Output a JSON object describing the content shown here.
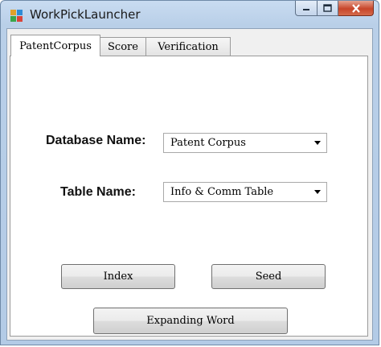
{
  "window": {
    "title": "WorkPickLauncher"
  },
  "tabs": [
    {
      "label": "PatentCorpus"
    },
    {
      "label": "Score"
    },
    {
      "label": "Verification"
    }
  ],
  "form": {
    "database_label": "Database Name:",
    "database_value": "Patent Corpus",
    "table_label": "Table Name:",
    "table_value": "Info & Comm Table"
  },
  "buttons": {
    "index": "Index",
    "seed": "Seed",
    "expanding_word": "Expanding Word"
  },
  "icons": {
    "app": "app-icon",
    "minimize": "minimize-icon",
    "maximize": "maximize-icon",
    "close": "close-icon",
    "dropdown": "chevron-down-icon"
  }
}
